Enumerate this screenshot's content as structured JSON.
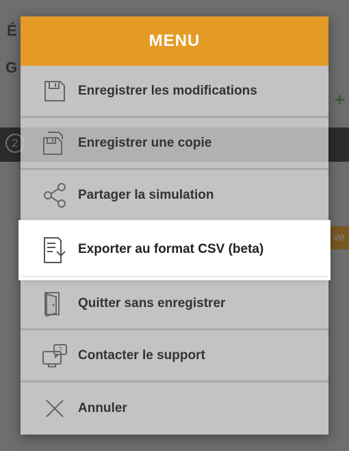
{
  "background": {
    "leftChar1": "É",
    "leftChar2": "G",
    "stepNumber": "2",
    "plus": "+",
    "orangeBtn": "ve"
  },
  "menu": {
    "title": "MENU",
    "items": [
      {
        "label": "Enregistrer les modifications",
        "icon": "save-icon",
        "highlighted": false
      },
      {
        "label": "Enregistrer une copie",
        "icon": "save-copy-icon",
        "highlighted": false
      },
      {
        "label": "Partager la simulation",
        "icon": "share-icon",
        "highlighted": false
      },
      {
        "label": "Exporter au format CSV (beta)",
        "icon": "export-icon",
        "highlighted": true
      },
      {
        "label": "Quitter sans enregistrer",
        "icon": "exit-icon",
        "highlighted": false
      },
      {
        "label": "Contacter le support",
        "icon": "support-icon",
        "highlighted": false
      },
      {
        "label": "Annuler",
        "icon": "close-icon",
        "highlighted": false
      }
    ]
  }
}
